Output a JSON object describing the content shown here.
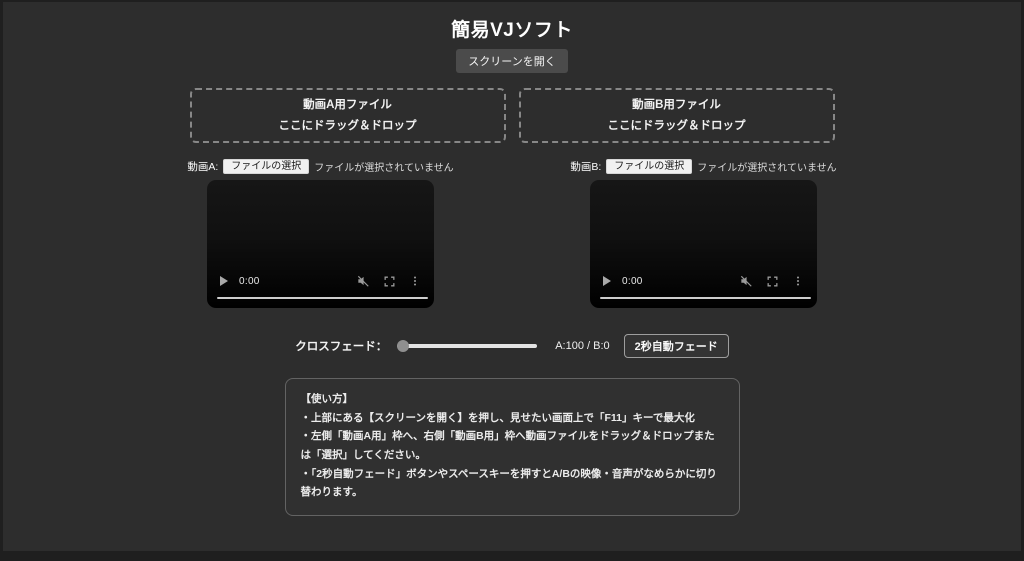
{
  "header": {
    "title": "簡易VJソフト",
    "open_screen_button": "スクリーンを開く"
  },
  "sections": {
    "a": {
      "dropzone_line1": "動画A用ファイル",
      "dropzone_line2": "ここにドラッグ＆ドロップ",
      "file_label": "動画A:",
      "video_time": "0:00"
    },
    "b": {
      "dropzone_line1": "動画B用ファイル",
      "dropzone_line2": "ここにドラッグ＆ドロップ",
      "file_label": "動画B:",
      "video_time": "0:00"
    },
    "file_choose_button": "ファイルの選択",
    "file_status": "ファイルが選択されていません"
  },
  "crossfade": {
    "label": "クロスフェード：",
    "slider_value": "0",
    "value_text": "A:100 / B:0",
    "auto_fade_button": "2秒自動フェード"
  },
  "usage": {
    "title": "【使い方】",
    "items": [
      "・上部にある【スクリーンを開く】を押し、見せたい画面上で「F11」キーで最大化",
      "・左側「動画A用」枠へ、右側「動画B用」枠へ動画ファイルをドラッグ＆ドロップまたは「選択」してください。",
      "・「2秒自動フェード」ボタンやスペースキーを押すとA/Bの映像・音声がなめらかに切り替わります。"
    ]
  },
  "icons": {
    "play": "play-triangle",
    "mute": "muted-speaker-with-slash",
    "fullscreen": "fullscreen-corner-brackets",
    "overflow": "vertical-three-dots"
  },
  "colors": {
    "page_background": "#2d2d2d",
    "frame_background": "#1f1f1f",
    "open_button_bg": "#4b4b4b",
    "dropzone_border": "#878787",
    "file_button_bg": "#f1f1f1",
    "video_bg": "#000000",
    "slider_track": "#e3e3e3",
    "slider_thumb": "#8f8f8f",
    "usage_border": "#636363",
    "text": "#ffffff"
  }
}
